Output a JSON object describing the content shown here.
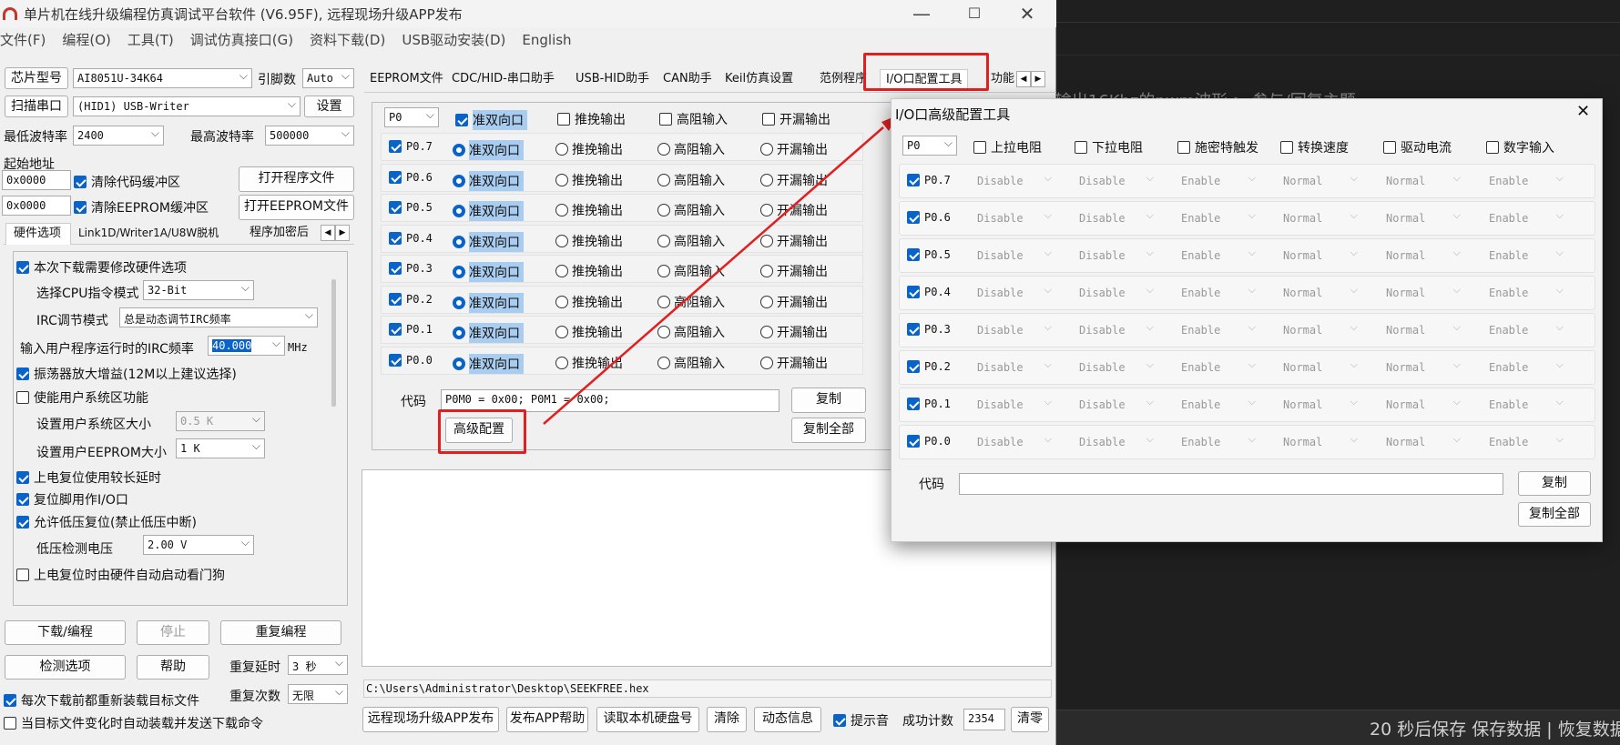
{
  "background": {
    "text1": "P输出16Khz的pwm波形  > 参与/回复主题",
    "status": "20 秒后保存 保存数据 | 恢复数据"
  },
  "window": {
    "title": "单片机在线升级编程仿真调试平台软件 (V6.95F), 远程现场升级APP发布",
    "minimize": "—",
    "maximize": "☐",
    "close": "✕"
  },
  "menu": [
    "文件(F)",
    "编程(O)",
    "工具(T)",
    "调试仿真接口(G)",
    "资料下载(D)",
    "USB驱动安装(D)",
    "English"
  ],
  "left": {
    "chip_label": "芯片型号",
    "chip_value": "AI8051U-34K64",
    "pin_label": "引脚数",
    "pin_value": "Auto",
    "scan_label": "扫描串口",
    "port_value": "(HID1) USB-Writer",
    "settings_label": "设置",
    "min_baud_label": "最低波特率",
    "min_baud_value": "2400",
    "max_baud_label": "最高波特率",
    "max_baud_value": "500000",
    "start_addr_label": "起始地址",
    "addr1": "0x0000",
    "addr2": "0x0000",
    "clear_code": "清除代码缓冲区",
    "clear_eeprom": "清除EEPROM缓冲区",
    "open_prog": "打开程序文件",
    "open_eeprom": "打开EEPROM文件",
    "tabs": [
      "硬件选项",
      "Link1D/Writer1A/U8W脱机",
      "程序加密后"
    ],
    "hw": {
      "need_modify": "本次下载需要修改硬件选项",
      "cpu_mode_label": "选择CPU指令模式",
      "cpu_mode_value": "32-Bit",
      "irc_mode_label": "IRC调节模式",
      "irc_mode_value": "总是动态调节IRC频率",
      "irc_freq_label": "输入用户程序运行时的IRC频率",
      "irc_freq_value": "40.000",
      "irc_unit": "MHz",
      "osc_gain": "振荡器放大增益(12M以上建议选择)",
      "user_sys": "使能用户系统区功能",
      "user_sys_size_label": "设置用户系统区大小",
      "user_sys_size_value": "0.5 K",
      "user_eeprom_label": "设置用户EEPROM大小",
      "user_eeprom_value": "1   K",
      "long_delay": "上电复位使用较长延时",
      "reset_io": "复位脚用作I/O口",
      "lvd_reset": "允许低压复位(禁止低压中断)",
      "lvd_label": "低压检测电压",
      "lvd_value": "2.00 V",
      "wdt": "上电复位时由硬件自动启动看门狗"
    },
    "btn_download": "下载/编程",
    "btn_stop": "停止",
    "btn_reprog": "重复编程",
    "btn_detect": "检测选项",
    "btn_help": "帮助",
    "repeat_delay_label": "重复延时",
    "repeat_delay_value": "3 秒",
    "repeat_count_label": "重复次数",
    "repeat_count_value": "无限",
    "reload_each": "每次下载前都重新装载目标文件",
    "auto_reload": "当目标文件变化时自动装载并发送下载命令"
  },
  "right": {
    "tabs": [
      "EEPROM文件",
      "CDC/HID-串口助手",
      "USB-HID助手",
      "CAN助手",
      "Keil仿真设置",
      "范例程序",
      "I/O口配置工具",
      "功能"
    ],
    "port_value": "P0",
    "modes": [
      "准双向口",
      "推挽输出",
      "高阻输入",
      "开漏输出"
    ],
    "pins": [
      "P0.7",
      "P0.6",
      "P0.5",
      "P0.4",
      "P0.3",
      "P0.2",
      "P0.1",
      "P0.0"
    ],
    "code_label": "代码",
    "code_value": "P0M0 = 0x00; P0M1 = 0x00;",
    "copy": "复制",
    "copy_all": "复制全部",
    "advanced": "高级配置",
    "filepath": "C:\\Users\\Administrator\\Desktop\\SEEKFREE.hex"
  },
  "bottom": {
    "btns": [
      "远程现场升级APP发布",
      "发布APP帮助",
      "读取本机硬盘号",
      "清除",
      "动态信息"
    ],
    "beep": "提示音",
    "success_label": "成功计数",
    "success_value": "2354",
    "reset": "清零"
  },
  "iowin": {
    "title": "I/O口高级配置工具",
    "close": "✕",
    "port_value": "P0",
    "headers": [
      "上拉电阻",
      "下拉电阻",
      "施密特触发",
      "转换速度",
      "驱动电流",
      "数字输入"
    ],
    "row_values": [
      "Disable",
      "Disable",
      "Enable",
      "Normal",
      "Normal",
      "Enable"
    ],
    "pins": [
      "P0.7",
      "P0.6",
      "P0.5",
      "P0.4",
      "P0.3",
      "P0.2",
      "P0.1",
      "P0.0"
    ],
    "code_label": "代码",
    "code_value": "",
    "copy": "复制",
    "copy_all": "复制全部"
  },
  "colors": {
    "highlight": "#a9cdf0",
    "check": "#0a63c8",
    "annotation": "#e02020"
  }
}
